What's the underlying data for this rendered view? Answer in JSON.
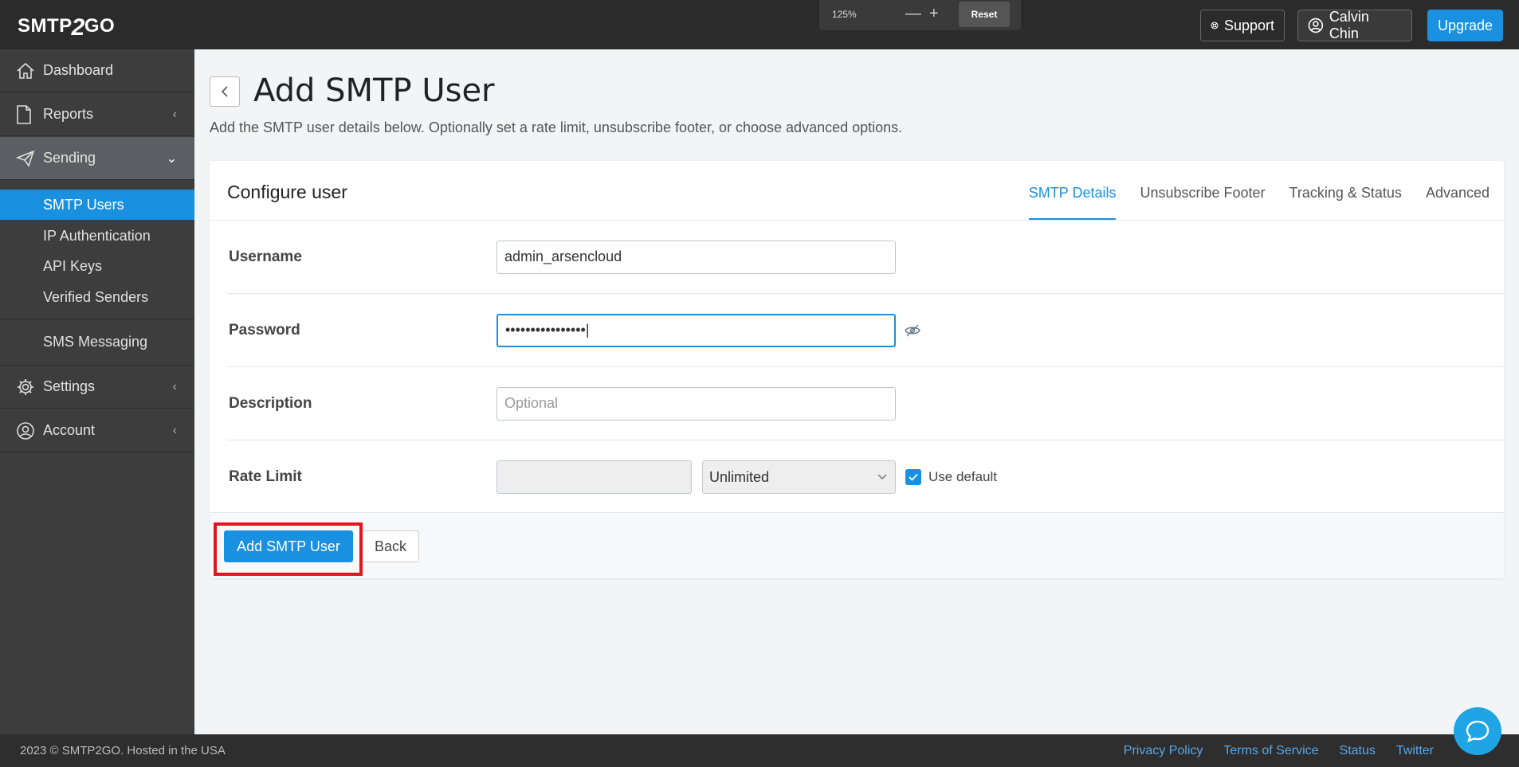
{
  "app": {
    "logo_text_a": "SMTP",
    "logo_text_b": "2",
    "logo_text_c": "GO"
  },
  "zoom": {
    "level": "125%",
    "minus": "—",
    "plus": "+",
    "reset": "Reset"
  },
  "header": {
    "support": "Support",
    "user": "Calvin Chin",
    "upgrade": "Upgrade"
  },
  "sidebar": {
    "dashboard": "Dashboard",
    "reports": "Reports",
    "sending": "Sending",
    "sub": [
      "SMTP Users",
      "IP Authentication",
      "API Keys",
      "Verified Senders"
    ],
    "sms": "SMS Messaging",
    "settings": "Settings",
    "account": "Account",
    "chev_left": "‹",
    "chev_down": "⌄"
  },
  "page": {
    "title": "Add SMTP User",
    "subtitle": "Add the SMTP user details below. Optionally set a rate limit, unsubscribe footer, or choose advanced options."
  },
  "card": {
    "title": "Configure user",
    "tabs": [
      "SMTP Details",
      "Unsubscribe Footer",
      "Tracking & Status",
      "Advanced"
    ]
  },
  "form": {
    "username_label": "Username",
    "username_value": "admin_arsencloud",
    "password_label": "Password",
    "password_value": "••••••••••••••••|",
    "description_label": "Description",
    "description_placeholder": "Optional",
    "rate_label": "Rate Limit",
    "rate_select": "Unlimited",
    "use_default": "Use default"
  },
  "buttons": {
    "submit": "Add SMTP User",
    "back": "Back"
  },
  "footer": {
    "copyright": "2023 © SMTP2GO. Hosted in the USA",
    "links": [
      "Privacy Policy",
      "Terms of Service",
      "Status",
      "Twitter"
    ]
  },
  "colors": {
    "accent": "#1a90e0",
    "sidebar": "#3d3d3d",
    "topbar": "#2b2b2b",
    "highlight": "#e0161f"
  }
}
